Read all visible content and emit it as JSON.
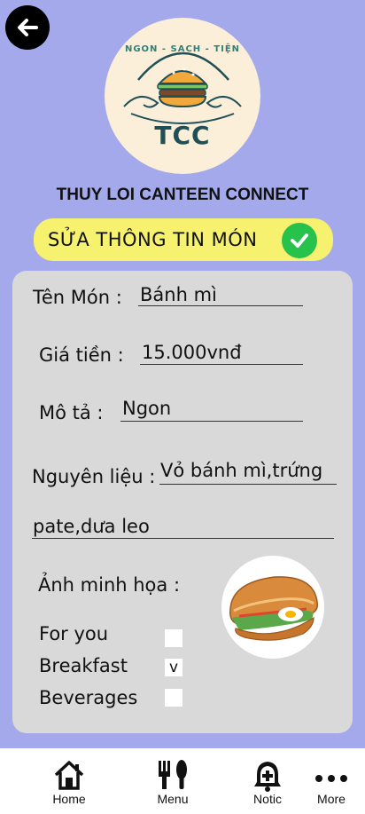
{
  "header": {
    "back_icon": "arrow-left-icon"
  },
  "logo": {
    "tagline": "NGON - SẠCH - TIỆN",
    "text": "TCC",
    "icon": "burger-icon"
  },
  "app_title": "THUY LOI CANTEEN CONNECT",
  "section": {
    "title": "SỬA THÔNG TIN MÓN",
    "confirm_icon": "check-icon",
    "confirm_color": "#27c24c",
    "pill_color": "#f6f16e"
  },
  "form": {
    "name_label": "Tên Món :",
    "name_value": "Bánh mì",
    "price_label": "Giá tiền :",
    "price_value": "15.000vnđ",
    "desc_label": "Mô tả :",
    "desc_value": "Ngon",
    "ingredients_label": "Nguyên liệu :",
    "ingredients_value_line1": "Vỏ bánh mì,trứng",
    "ingredients_value_line2": "pate,dưa leo",
    "image_label": "Ảnh minh họa :"
  },
  "categories": [
    {
      "label": "For you",
      "mark": ""
    },
    {
      "label": "Breakfast",
      "mark": "v"
    },
    {
      "label": "Beverages",
      "mark": ""
    }
  ],
  "nav": [
    {
      "label": "Home",
      "icon": "home-icon"
    },
    {
      "label": "Menu",
      "icon": "utensils-icon"
    },
    {
      "label": "Notic",
      "icon": "bell-icon"
    },
    {
      "label": "More",
      "icon": "more-icon"
    }
  ],
  "colors": {
    "background": "#a3a9ea",
    "card": "#d9d9d9"
  }
}
